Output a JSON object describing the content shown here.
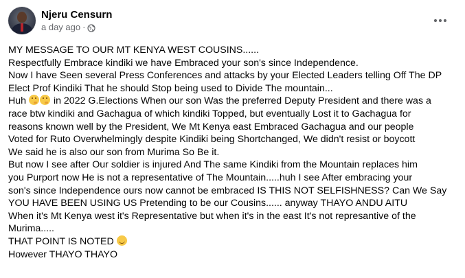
{
  "post": {
    "author": "Njeru Censurn",
    "time": "a day ago",
    "separator": "·",
    "lines": [
      "MY MESSAGE TO OUR MT KENYA WEST COUSINS......",
      "Respectfully Embrace kindiki we have Embraced your son's since Independence.",
      "Now I have Seen several Press Conferences and attacks by your Elected Leaders telling Off The DP",
      "Elect Prof Kindiki That he should Stop being used to Divide The mountain...",
      "in 2022 G.Elections When our son Was the preferred Deputy President and there was a",
      "race btw kindiki and Gachagua of which kindiki Topped, but eventually Lost it to Gachagua for",
      "reasons known well  by the President,  We Mt Kenya east Embraced Gachagua and our people",
      "Voted for Ruto Overwhelmingly despite Kindiki being Shortchanged, We didn't resist or boycott",
      "We said he is also our son from Murima So Be it.",
      "But now I see after Our soldier is injured And The same Kindiki from the Mountain replaces him",
      "you Purport now He is not a representative of The Mountain.....huh I see After embracing your",
      "son's since Independence ours now cannot be embraced IS THIS NOT SELFISHNESS? Can We Say",
      "YOU HAVE BEEN USING US Pretending to be our Cousins...... anyway THAYO ANDU AITU",
      "When it's Mt Kenya west it's Representative but when it's in the east It's not represantive of the",
      "Murima.....",
      "THAT POINT IS NOTED",
      "However THAYO THAYO"
    ],
    "huh_prefix": "Huh",
    "icons": {
      "more": "more-options-icon",
      "privacy": "globe-icon",
      "emoji_thinking": "thinking-face-emoji",
      "emoji_smile": "smiling-face-emoji"
    }
  }
}
